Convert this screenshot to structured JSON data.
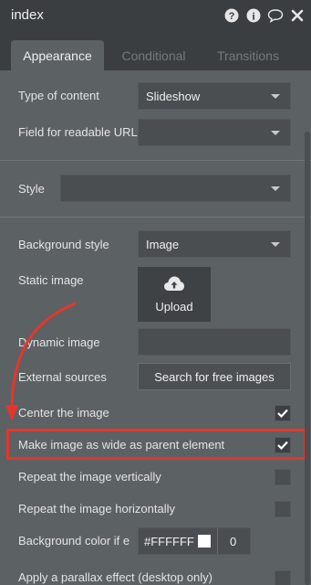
{
  "window": {
    "title": "index"
  },
  "title_icons": [
    "help-icon",
    "info-icon",
    "comment-icon",
    "close-icon"
  ],
  "tabs": [
    {
      "label": "Appearance",
      "active": true
    },
    {
      "label": "Conditional",
      "active": false
    },
    {
      "label": "Transitions",
      "active": false
    }
  ],
  "fields": {
    "type_of_content": {
      "label": "Type of content",
      "value": "Slideshow"
    },
    "readable_url": {
      "label": "Field for readable URL",
      "value": ""
    },
    "style": {
      "label": "Style",
      "value": ""
    },
    "background_style": {
      "label": "Background style",
      "value": "Image"
    },
    "static_image": {
      "label": "Static image",
      "button": "Upload"
    },
    "dynamic_image": {
      "label": "Dynamic image",
      "value": ""
    },
    "external_sources": {
      "label": "External sources",
      "button": "Search for free images"
    },
    "center_image": {
      "label": "Center the image",
      "checked": true
    },
    "wide_as_parent": {
      "label": "Make image as wide as parent element",
      "checked": true
    },
    "repeat_vertical": {
      "label": "Repeat the image vertically",
      "checked": false
    },
    "repeat_horizontal": {
      "label": "Repeat the image horizontally",
      "checked": false
    },
    "bg_color": {
      "label": "Background color if e",
      "hex": "#FFFFFF",
      "opacity": "0"
    },
    "parallax": {
      "label": "Apply a parallax effect (desktop only)",
      "checked": false
    }
  },
  "colors": {
    "highlight": "#e5362b",
    "arrow": "#e5362b"
  }
}
